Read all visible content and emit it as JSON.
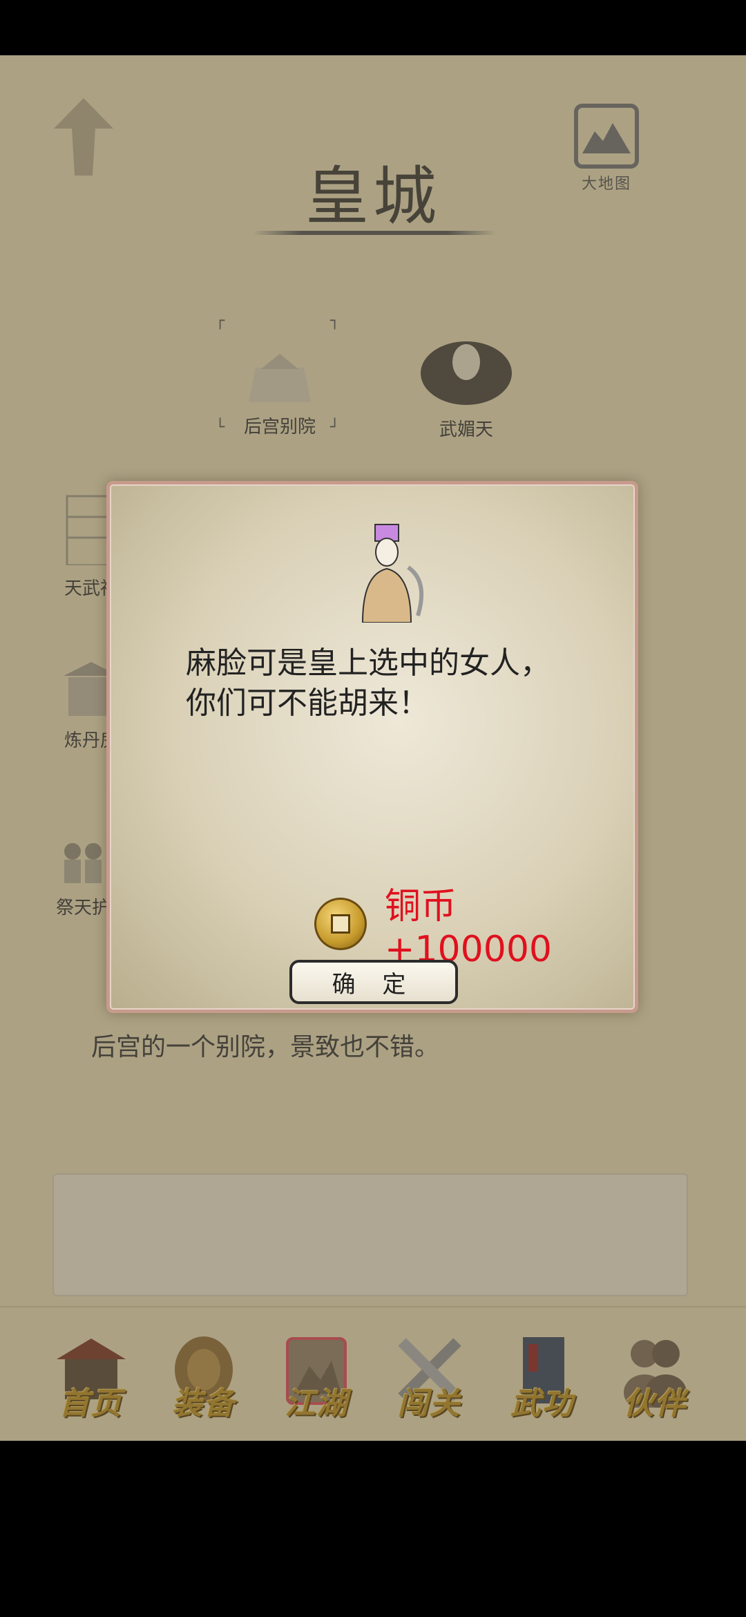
{
  "header": {
    "title": "皇城",
    "map_label": "大地图"
  },
  "locations": [
    {
      "label": "后宫别院"
    },
    {
      "label": "武媚天"
    },
    {
      "label": "天武神"
    },
    {
      "label": "炼丹房"
    },
    {
      "label": "祭天护"
    }
  ],
  "location_description": "后宫的一个别院，景致也不错。",
  "nav": [
    {
      "label": "首页"
    },
    {
      "label": "装备"
    },
    {
      "label": "江湖"
    },
    {
      "label": "闯关"
    },
    {
      "label": "武功"
    },
    {
      "label": "伙伴"
    }
  ],
  "dialog": {
    "message_line1": "麻脸可是皇上选中的女人，",
    "message_line2": "你们可不能胡来！",
    "reward_text": "铜币 +100000",
    "confirm_label": "确 定"
  },
  "colors": {
    "reward": "#e0101e",
    "nav_text": "#b18a2a",
    "background": "#d9cdaa"
  }
}
